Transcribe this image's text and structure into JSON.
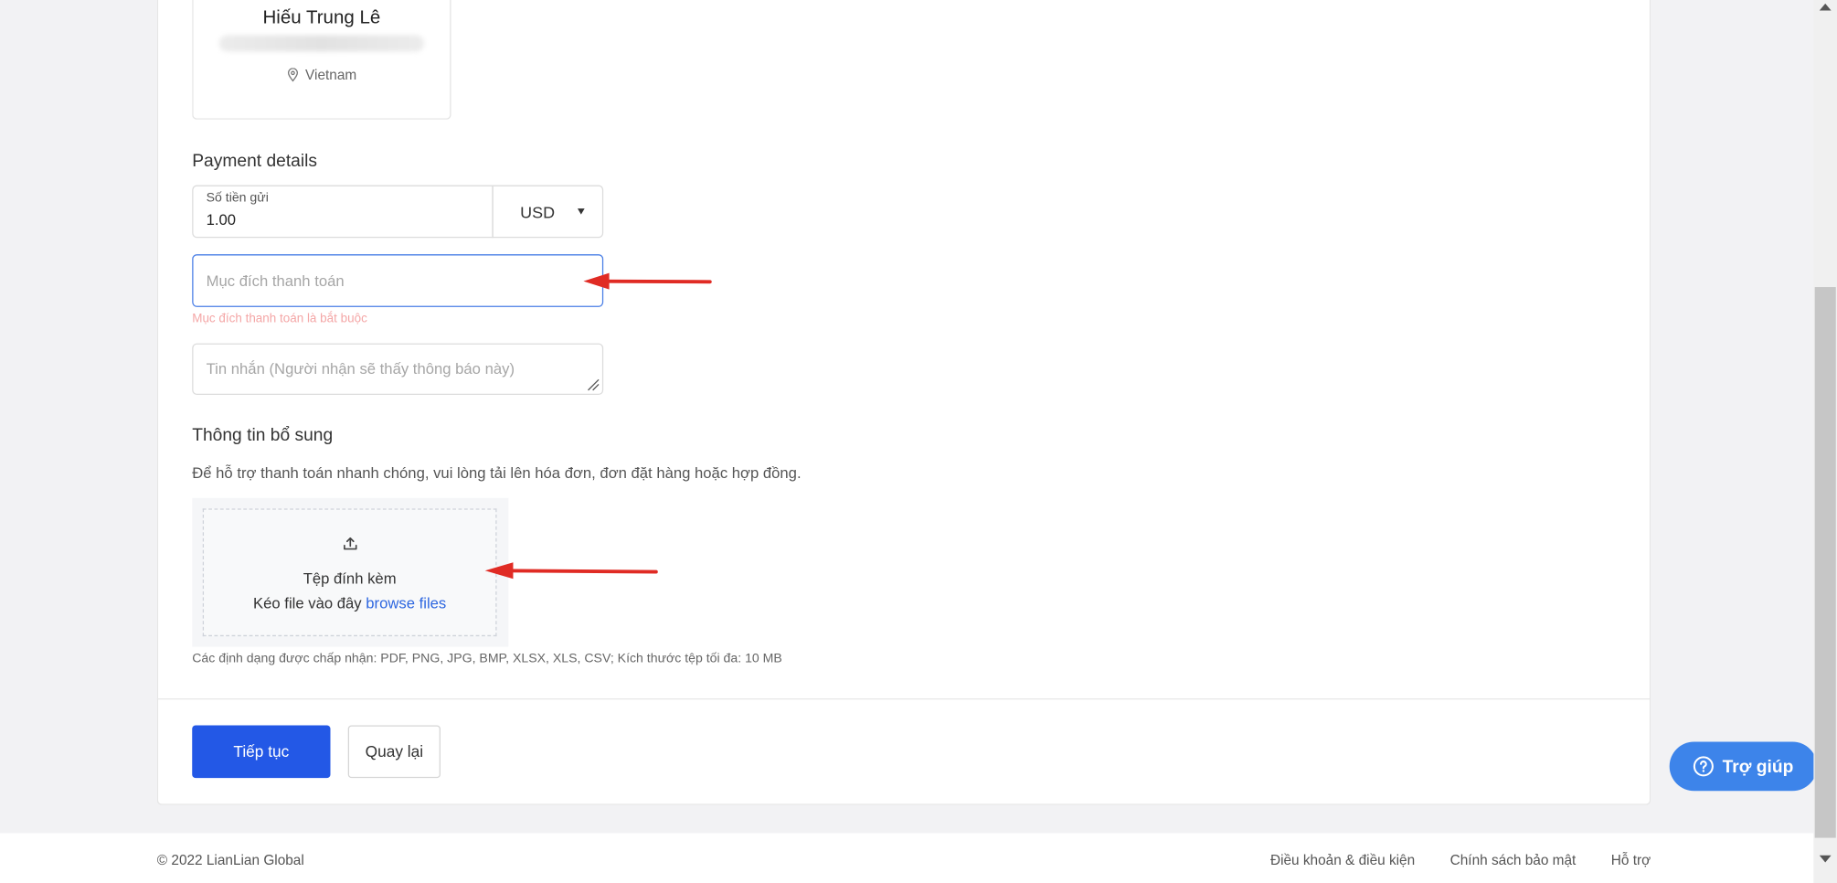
{
  "recipient": {
    "name": "Hiếu Trung Lê",
    "country": "Vietnam"
  },
  "payment": {
    "section_title": "Payment details",
    "amount_label": "Số tiền gửi",
    "amount_value": "1.00",
    "currency": "USD",
    "purpose_placeholder": "Mục đích thanh toán",
    "purpose_error": "Mục đích thanh toán là bắt buộc",
    "message_placeholder": "Tin nhắn (Người nhận sẽ thấy thông báo này)"
  },
  "additional": {
    "section_title": "Thông tin bổ sung",
    "help_text": "Để hỗ trợ thanh toán nhanh chóng, vui lòng tải lên hóa đơn, đơn đặt hàng hoặc hợp đồng.",
    "upload_title": "Tệp đính kèm",
    "upload_drag_text": "Kéo file vào đây",
    "upload_browse": "browse files",
    "formats_note": "Các định dạng được chấp nhận: PDF, PNG, JPG, BMP, XLSX, XLS, CSV; Kích thước tệp tối đa: 10 MB"
  },
  "actions": {
    "continue": "Tiếp tục",
    "back": "Quay lại"
  },
  "footer": {
    "copyright": "© 2022 LianLian Global",
    "links": [
      "Điều khoản & điều kiện",
      "Chính sách bảo mật",
      "Hỗ trợ"
    ]
  },
  "help_widget": {
    "label": "Trợ giúp"
  },
  "colors": {
    "primary": "#2358e6",
    "link": "#2e67e0",
    "error": "#f4a6a6",
    "focus": "#4a7fe6",
    "help_widget": "#3d84ea",
    "annotation_arrow": "#e02b24"
  }
}
